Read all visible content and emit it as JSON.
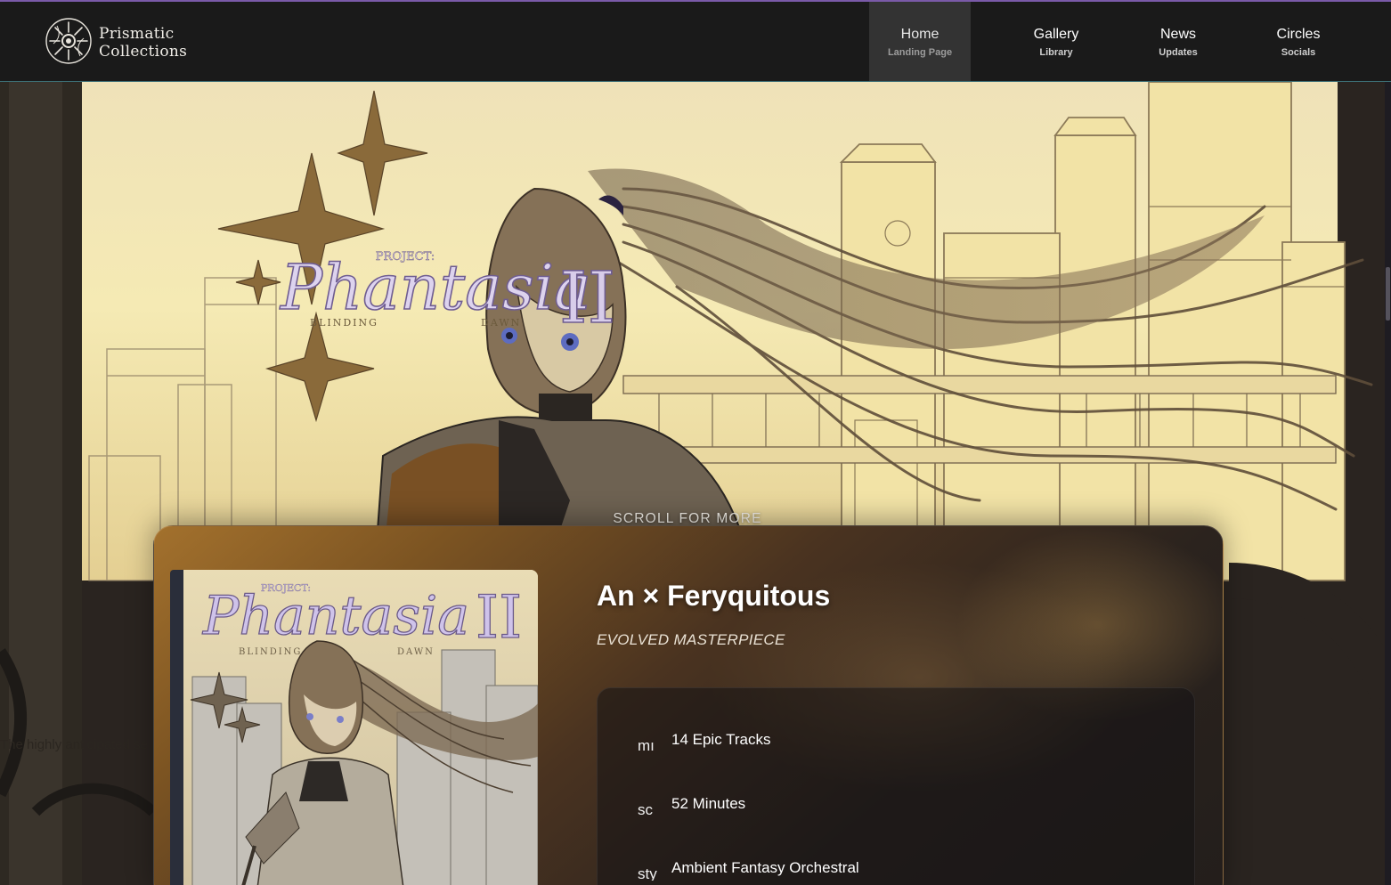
{
  "brand": {
    "line1": "Prismatic",
    "line2": "Collections",
    "logo_icon": "sun-burst-logo-icon"
  },
  "nav": [
    {
      "label": "Home",
      "sub": "Landing Page",
      "active": true
    },
    {
      "label": "Gallery",
      "sub": "Library",
      "active": false
    },
    {
      "label": "News",
      "sub": "Updates",
      "active": false
    },
    {
      "label": "Circles",
      "sub": "Socials",
      "active": false
    }
  ],
  "hero": {
    "logo": {
      "prefix": "PROJECT:",
      "name": "Phantasia",
      "numeral": "II",
      "left_word": "BLINDING",
      "right_word": "DAWN"
    },
    "scroll_hint": "SCROLL FOR MORE",
    "scroll_icon": "triangle-down-icon",
    "tagline": "The highly anticipated se"
  },
  "album": {
    "title": "An × Feryquitous",
    "subtitle": "EVOLVED MASTERPIECE",
    "cover_logo": {
      "prefix": "PROJECT:",
      "name": "Phantasia",
      "numeral": "II",
      "left_word": "BLINDING",
      "right_word": "DAWN"
    },
    "details": [
      {
        "icon": "music-note-icon",
        "icon_fallback": "mı",
        "text": "14 Epic Tracks"
      },
      {
        "icon": "clock-icon",
        "icon_fallback": "sc",
        "text": "52 Minutes"
      },
      {
        "icon": "style-icon",
        "icon_fallback": "sty",
        "text": "Ambient Fantasy Orchestral"
      }
    ]
  },
  "colors": {
    "header_bg": "#1a1a1a",
    "accent_line": "#7a5aa8",
    "card_warm": "#a3712d",
    "card_dark": "#231e1b"
  }
}
